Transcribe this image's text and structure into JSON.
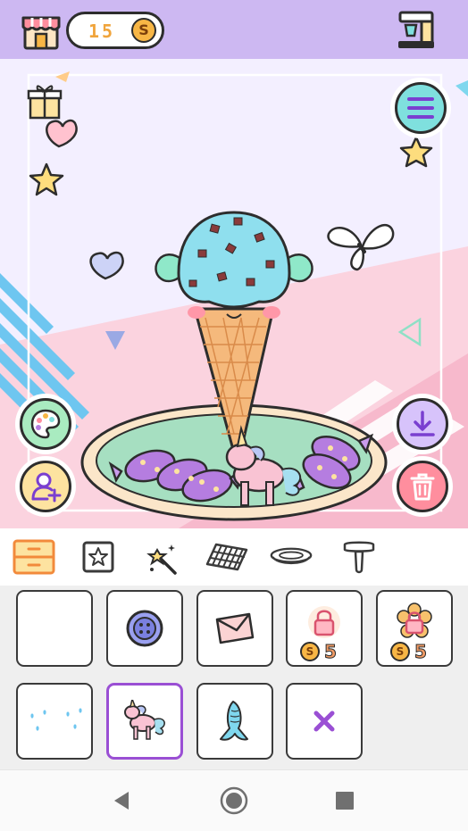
{
  "header": {
    "shop_icon": "shop-icon",
    "coin_count": "15",
    "coin_symbol": "S",
    "kitchen_icon": "kitchen-icon"
  },
  "canvas": {
    "side_buttons": [
      "menu-icon",
      "palette-icon",
      "add-character-icon",
      "download-icon",
      "trash-icon"
    ]
  },
  "categories": [
    "drawer-icon",
    "star-frame-icon",
    "magic-wand-icon",
    "tablecloth-icon",
    "plate-icon",
    "stand-icon"
  ],
  "items": [
    {
      "name": "empty",
      "price": ""
    },
    {
      "name": "button-icon",
      "price": ""
    },
    {
      "name": "envelope-icon",
      "price": ""
    },
    {
      "name": "locked-item-icon",
      "price": "5"
    },
    {
      "name": "locked-flower-item-icon",
      "price": "5"
    },
    {
      "name": "raindrops-icon",
      "price": ""
    },
    {
      "name": "unicorn-icon",
      "price": ""
    },
    {
      "name": "mermaid-tail-icon",
      "price": ""
    },
    {
      "name": "remove-x-icon",
      "price": ""
    }
  ],
  "price_coin_symbol": "S",
  "colors": {
    "topbar": "#cdb8f2",
    "coin": "#f7b645",
    "selected_border": "#9a4fd4",
    "menu_button": "#7fe0de",
    "trash_button": "#ff8e9e"
  },
  "navbar": [
    "back-icon",
    "home-icon",
    "recents-icon"
  ]
}
